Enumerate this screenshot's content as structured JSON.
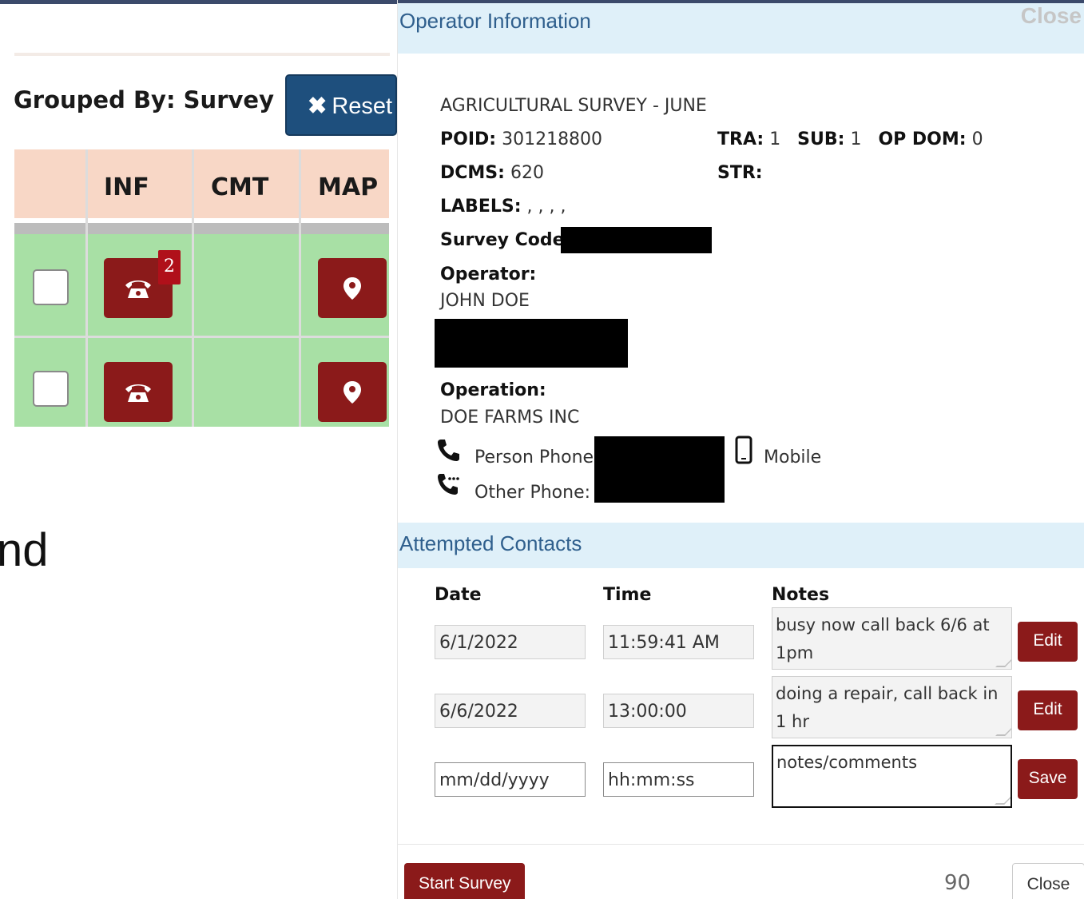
{
  "background": {
    "grouped_label": "Grouped By: Survey",
    "reset_label": "Reset",
    "columns": [
      "INF",
      "CMT",
      "MAP"
    ],
    "inf_badge": "2",
    "partial_text": "nd"
  },
  "modal": {
    "title": "Operator Information",
    "close_x": "Close",
    "survey_name": "AGRICULTURAL SURVEY - JUNE",
    "poid_label": "POID:",
    "poid_value": "301218800",
    "tra_label": "TRA:",
    "tra_value": "1",
    "sub_label": "SUB:",
    "sub_value": "1",
    "opdom_label": "OP DOM:",
    "opdom_value": "0",
    "dcms_label": "DCMS:",
    "dcms_value": "620",
    "str_label": "STR:",
    "labels_label": "LABELS:",
    "labels_value": ", , , ,",
    "survey_code_label": "Survey Code:",
    "operator_label": "Operator:",
    "operator_name": "JOHN DOE",
    "operation_label": "Operation:",
    "operation_name": "DOE FARMS INC",
    "person_phone_label": "Person Phone:",
    "other_phone_label": "Other Phone:",
    "mobile_label": "Mobile",
    "attempted_title": "Attempted Contacts",
    "headers": {
      "date": "Date",
      "time": "Time",
      "notes": "Notes"
    },
    "contacts": [
      {
        "date": "6/1/2022",
        "time": "11:59:41 AM",
        "notes": "busy now call back 6/6 at 1pm",
        "action": "Edit"
      },
      {
        "date": "6/6/2022",
        "time": "13:00:00",
        "notes": "doing a repair, call back in 1 hr",
        "action": "Edit"
      }
    ],
    "new_contact": {
      "date_placeholder": "mm/dd/yyyy",
      "time_placeholder": "hh:mm:ss",
      "notes_placeholder": "notes/comments",
      "action": "Save"
    },
    "start_survey_label": "Start Survey",
    "count": "90",
    "close_label": "Close"
  }
}
